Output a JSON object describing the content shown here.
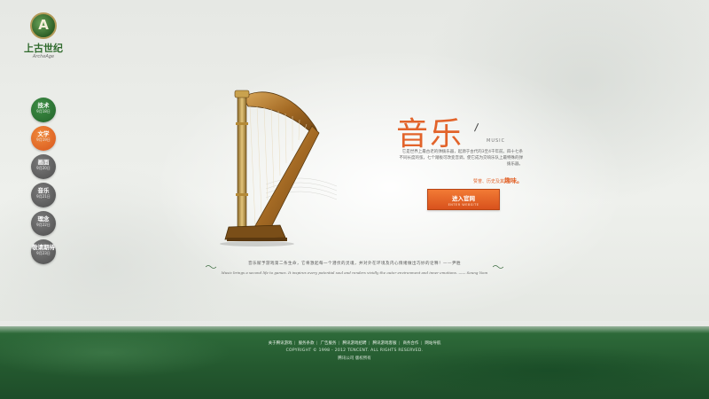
{
  "logo": {
    "title": "上古世纪",
    "subtitle": "ArcheAge"
  },
  "sidenav": {
    "items": [
      {
        "label": "技术",
        "date": "9月18日",
        "color": "#2e7a35"
      },
      {
        "label": "文学",
        "date": "9月19日",
        "color": "#e2632a"
      },
      {
        "label": "画面",
        "date": "9月20日",
        "color": "#5e5e5e"
      },
      {
        "label": "音乐",
        "date": "9月21日",
        "color": "#5e5e5e"
      },
      {
        "label": "理念",
        "date": "9月22日",
        "color": "#5e5e5e"
      },
      {
        "label": "敬请期待",
        "date": "9月23日",
        "color": "#5e5e5e"
      }
    ]
  },
  "main": {
    "title": "音乐",
    "title_en": "MUSIC",
    "description": "它是世界上最古老的弹拨乐器，起源于古代的3至4千年前。四十七条不同长度的弦，七个踏板可改变音调，使它成为交响乐队上最特殊的弹拨乐器。",
    "tagline_prefix": "赞誉、历史及其",
    "tagline_emphasis": "趣味。",
    "enter_button_label": "进入官网",
    "enter_button_sub": "ENTER WEBSITE"
  },
  "quote": {
    "cn": "音乐赋予游戏第二条生命，它将激起每一个潜伏的灵魂，并对外在环境及内心情绪做出巧妙的诠释！——尹胜",
    "en": "Music brings a second life to games. It inspires every potential soul and renders vividly the outer environment and inner emotions. —— Seung Yoon"
  },
  "footer": {
    "links": [
      "关于腾讯游戏",
      "服务条款",
      "广告服务",
      "腾讯游戏招聘",
      "腾讯游戏客服",
      "商务合作",
      "网站导航"
    ],
    "copyright": "COPYRIGHT © 1998 - 2012 TENCENT. ALL RIGHTS RESERVED.",
    "extra": "腾讯公司 版权所有"
  },
  "colors": {
    "accent": "#e2632a",
    "brand_green": "#2e7a35",
    "footer_green": "#24592f"
  }
}
